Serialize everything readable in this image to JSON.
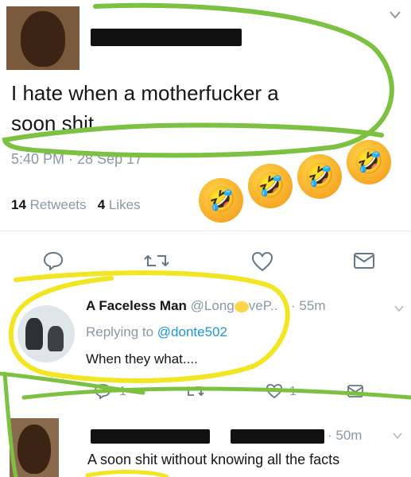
{
  "tweet": {
    "text_line1": "I hate when a motherfucker a",
    "text_line2": "soon shit",
    "timestamp": "5:40 PM · 28 Sep 17",
    "retweets_count": "14",
    "retweets_label": "Retweets",
    "likes_count": "4",
    "likes_label": "Likes",
    "emoji_reaction": "🤣"
  },
  "reply1": {
    "name": "A Faceless Man",
    "handle": "@Long",
    "handle_tail": "veP..",
    "time": "· 55m",
    "replying_prefix": "Replying to",
    "replying_to": "@donte502",
    "text": "When they what....",
    "reply_count": "1",
    "like_count": "1"
  },
  "reply2": {
    "time": "· 50m",
    "text": "A soon shit without knowing all the facts"
  },
  "colors": {
    "accent": "#1b95e0",
    "highlight_green": "#7cc142",
    "highlight_yellow": "#f2e521"
  }
}
